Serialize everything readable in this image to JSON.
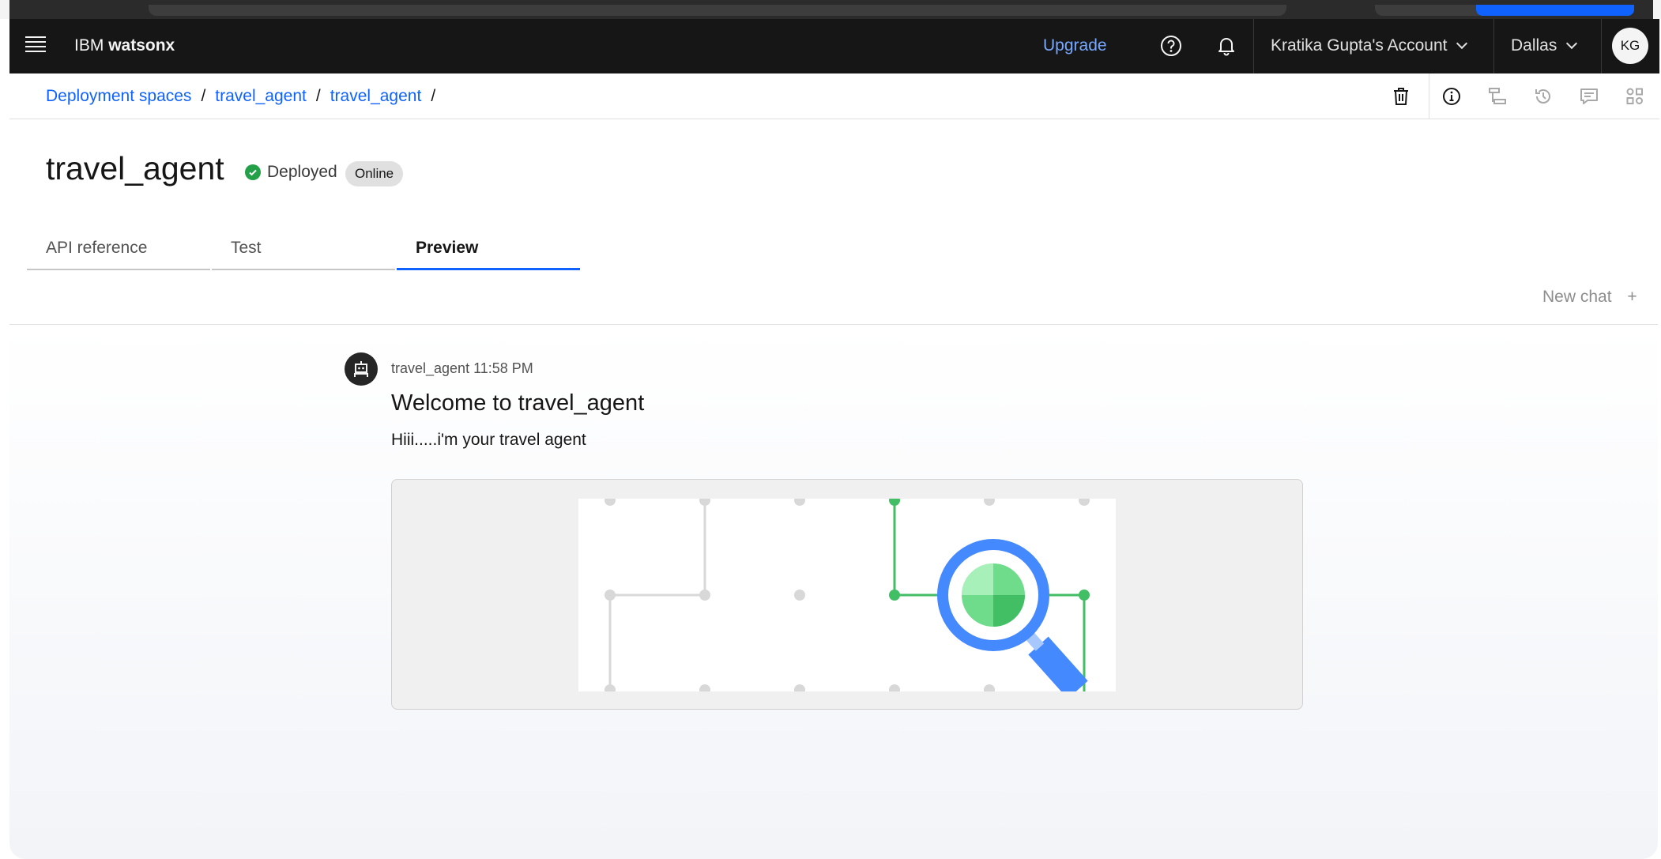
{
  "header": {
    "brand_prefix": "IBM",
    "brand_name": "watsonx",
    "upgrade_label": "Upgrade",
    "account_label": "Kratika Gupta's Account",
    "region_label": "Dallas",
    "avatar_initials": "KG"
  },
  "breadcrumb": {
    "items": [
      "Deployment spaces",
      "travel_agent",
      "travel_agent"
    ],
    "separator": "/"
  },
  "deployment": {
    "title": "travel_agent",
    "status": "Deployed",
    "tag": "Online"
  },
  "tabs": [
    {
      "label": "API reference",
      "active": false
    },
    {
      "label": "Test",
      "active": false
    },
    {
      "label": "Preview",
      "active": true
    }
  ],
  "chat": {
    "new_chat_label": "New chat",
    "new_chat_icon": "+",
    "sender": "travel_agent",
    "time": "11:58 PM",
    "welcome_title": "Welcome to travel_agent",
    "message": "Hiii.....i'm your travel agent"
  },
  "colors": {
    "accent": "#0f62fe",
    "success": "#24a148",
    "header_bg": "#161616",
    "link": "#78a9ff"
  }
}
